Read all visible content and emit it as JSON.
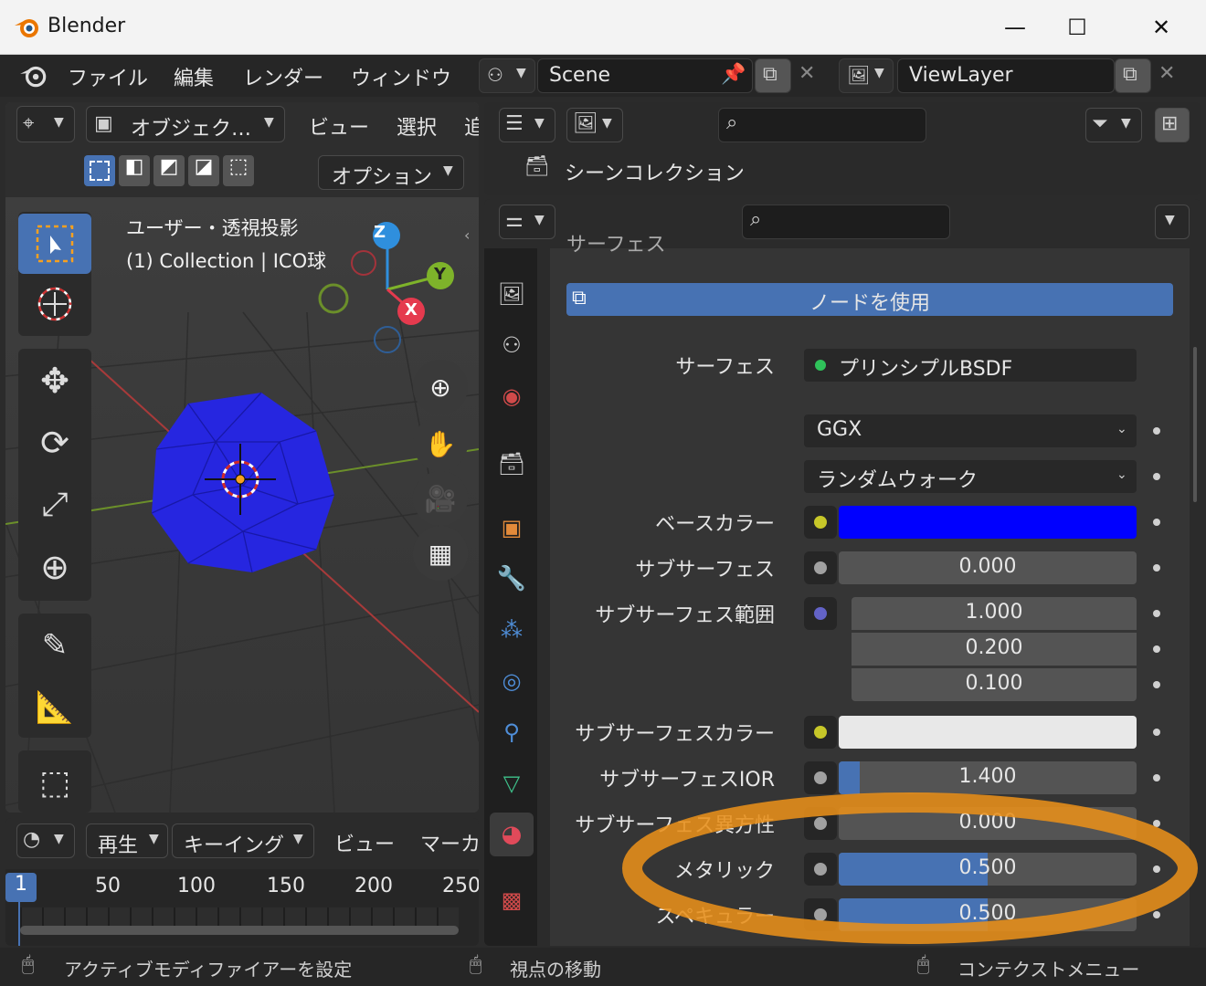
{
  "window": {
    "title": "Blender",
    "min": "—",
    "max": "☐",
    "close": "✕"
  },
  "menu": {
    "file": "ファイル",
    "edit": "編集",
    "render": "レンダー",
    "window": "ウィンドウ"
  },
  "scene": {
    "name": "Scene"
  },
  "viewlayer": {
    "name": "ViewLayer"
  },
  "viewport": {
    "mode": "オブジェク…",
    "view": "ビュー",
    "select": "選択",
    "add": "追",
    "options": "オプション",
    "overlay_title": "ユーザー・透視投影",
    "overlay_sub": "(1) Collection | ICO球",
    "gizmo": {
      "z": "Z",
      "y": "Y",
      "x": "X"
    }
  },
  "outliner": {
    "root": "シーンコレクション"
  },
  "properties": {
    "section_header": "サーフェス",
    "use_nodes": "ノードを使用",
    "rows": {
      "surface_label": "サーフェス",
      "surface_value": "プリンシプルBSDF",
      "distribution": "GGX",
      "subsurface_method": "ランダムウォーク",
      "base_color_label": "ベースカラー",
      "subsurface_label": "サブサーフェス",
      "subsurface_value": "0.000",
      "subsurface_radius_label": "サブサーフェス範囲",
      "radius_1": "1.000",
      "radius_2": "0.200",
      "radius_3": "0.100",
      "subsurface_color_label": "サブサーフェスカラー",
      "subsurface_ior_label": "サブサーフェスIOR",
      "subsurface_ior_value": "1.400",
      "subsurface_aniso_label": "サブサーフェス異方性",
      "subsurface_aniso_value": "0.000",
      "metallic_label": "メタリック",
      "metallic_value": "0.500",
      "specular_label": "スペキュラー",
      "specular_value": "0.500"
    },
    "fractions": {
      "subsurface_ior": 0.07,
      "metallic": 0.5,
      "specular": 0.5
    },
    "colors": {
      "base": "#0000ff",
      "subsurface": "#e8e8e8",
      "accent": "#4772b3",
      "highlight": "#e8901a"
    }
  },
  "timeline": {
    "play": "再生",
    "keying": "キーイング",
    "view": "ビュー",
    "marker": "マーカ",
    "current_frame": "1",
    "ticks": [
      "50",
      "100",
      "150",
      "200",
      "250"
    ]
  },
  "statusbar": {
    "left": "アクティブモディファイアーを設定",
    "middle": "視点の移動",
    "right": "コンテクストメニュー"
  }
}
